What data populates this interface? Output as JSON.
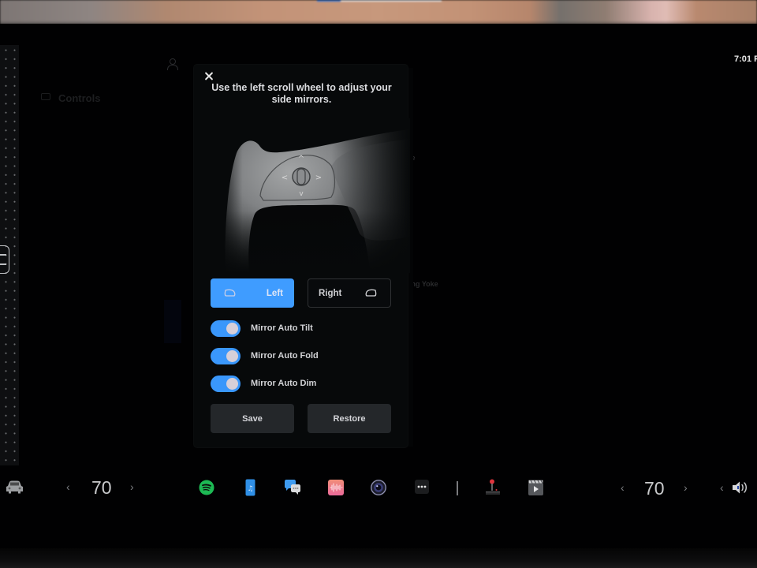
{
  "status_bar": {
    "time": "7:01 P"
  },
  "background": {
    "controls_label": "Controls",
    "partial_text_1": "le",
    "partial_text_2": "ing Yoke"
  },
  "modal": {
    "title": "Use the left scroll wheel to adjust your side mirrors.",
    "close_icon": "close-icon",
    "illustration": "steering-yoke-scroll-wheel",
    "scroll_wheel_directions": [
      "^",
      "<",
      ">",
      "v"
    ],
    "mirror_select": {
      "selected": "Left",
      "options": [
        {
          "label": "Left",
          "icon": "left-mirror-icon",
          "active": true
        },
        {
          "label": "Right",
          "icon": "right-mirror-icon",
          "active": false
        }
      ]
    },
    "toggles": [
      {
        "label": "Mirror Auto Tilt",
        "on": true
      },
      {
        "label": "Mirror Auto Fold",
        "on": true
      },
      {
        "label": "Mirror Auto Dim",
        "on": true
      }
    ],
    "buttons": {
      "save": "Save",
      "restore": "Restore"
    }
  },
  "dock": {
    "car_icon": "car-icon",
    "driver_temp": "70",
    "passenger_temp": "70",
    "temp_prev": "‹",
    "temp_next": "›",
    "apps": [
      {
        "name": "spotify",
        "icon": "spotify-icon",
        "color": "#1db954"
      },
      {
        "name": "music",
        "icon": "music-icon",
        "color": "#2f8fe6"
      },
      {
        "name": "messages",
        "icon": "messages-icon",
        "color": "#3e9bf0"
      },
      {
        "name": "voice-recorder",
        "icon": "voice-recorder-icon",
        "color": "#ee7b8d"
      },
      {
        "name": "camera",
        "icon": "camera-icon",
        "color": "#4d4f8a"
      },
      {
        "name": "more",
        "icon": "more-icon",
        "color": "#1c1d1f"
      },
      {
        "name": "arcade",
        "icon": "joystick-icon",
        "color": "#e0343d"
      },
      {
        "name": "theater",
        "icon": "theater-icon",
        "color": "#5a5c60"
      }
    ],
    "volume_icon": "volume-icon"
  },
  "colors": {
    "accent": "#3f9cff",
    "toggle_on": "#3a97fb",
    "modal_bg": "#07090a",
    "button_bg": "#24272a"
  }
}
